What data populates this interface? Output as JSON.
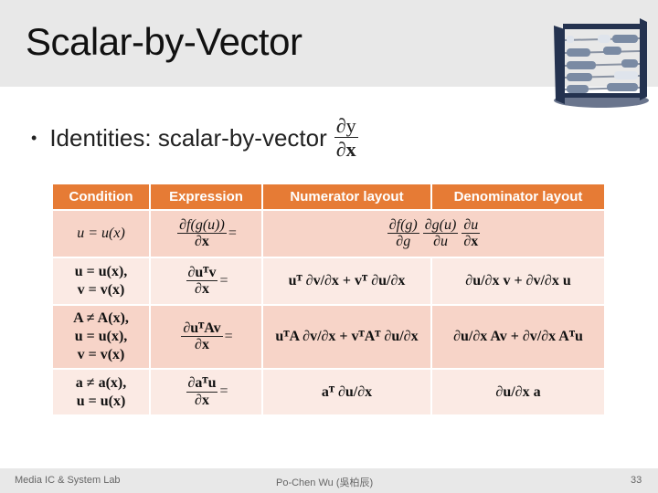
{
  "slide": {
    "title": "Scalar-by-Vector",
    "logo_icon": "abacus-icon",
    "bullet": {
      "text": "Identities: scalar-by-vector",
      "fraction_num": "∂y",
      "fraction_den": "∂x"
    }
  },
  "table": {
    "headers": [
      "Condition",
      "Expression",
      "Numerator layout",
      "Denominator layout"
    ],
    "colors": {
      "header": "#e67b35",
      "row_dark": "#f7d4c8",
      "row_light": "#fbeae4"
    },
    "rows": [
      {
        "condition": [
          "u = u(x)"
        ],
        "expression": {
          "num": "∂f(g(u))",
          "den": "∂x",
          "eq": "="
        },
        "merged": true,
        "result": "(∂f(g)/∂g)(∂g(u)/∂u)(∂u/∂x)",
        "result_parts": [
          {
            "num": "∂f(g)",
            "den": "∂g"
          },
          {
            "num": "∂g(u)",
            "den": "∂u"
          },
          {
            "num": "∂u",
            "den": "∂x"
          }
        ]
      },
      {
        "condition": [
          "u = u(x),",
          "v = v(x)"
        ],
        "expression": {
          "num": "∂uᵀv",
          "den": "∂x",
          "eq": "="
        },
        "numerator_layout": "uᵀ ∂v/∂x + vᵀ ∂u/∂x",
        "denominator_layout": "∂u/∂x v + ∂v/∂x u"
      },
      {
        "condition": [
          "A ≠ A(x),",
          "u = u(x),",
          "v = v(x)"
        ],
        "expression": {
          "num": "∂uᵀAv",
          "den": "∂x",
          "eq": "="
        },
        "numerator_layout": "uᵀA ∂v/∂x + vᵀAᵀ ∂u/∂x",
        "denominator_layout": "∂u/∂x Av + ∂v/∂x Aᵀu"
      },
      {
        "condition": [
          "a ≠ a(x),",
          "u = u(x)"
        ],
        "expression": {
          "num": "∂aᵀu",
          "den": "∂x",
          "eq": "="
        },
        "numerator_layout": "aᵀ ∂u/∂x",
        "denominator_layout": "∂u/∂x a"
      }
    ]
  },
  "footer": {
    "left": "Media IC & System Lab",
    "center": "Po-Chen Wu (吳柏辰)",
    "page": "33"
  }
}
